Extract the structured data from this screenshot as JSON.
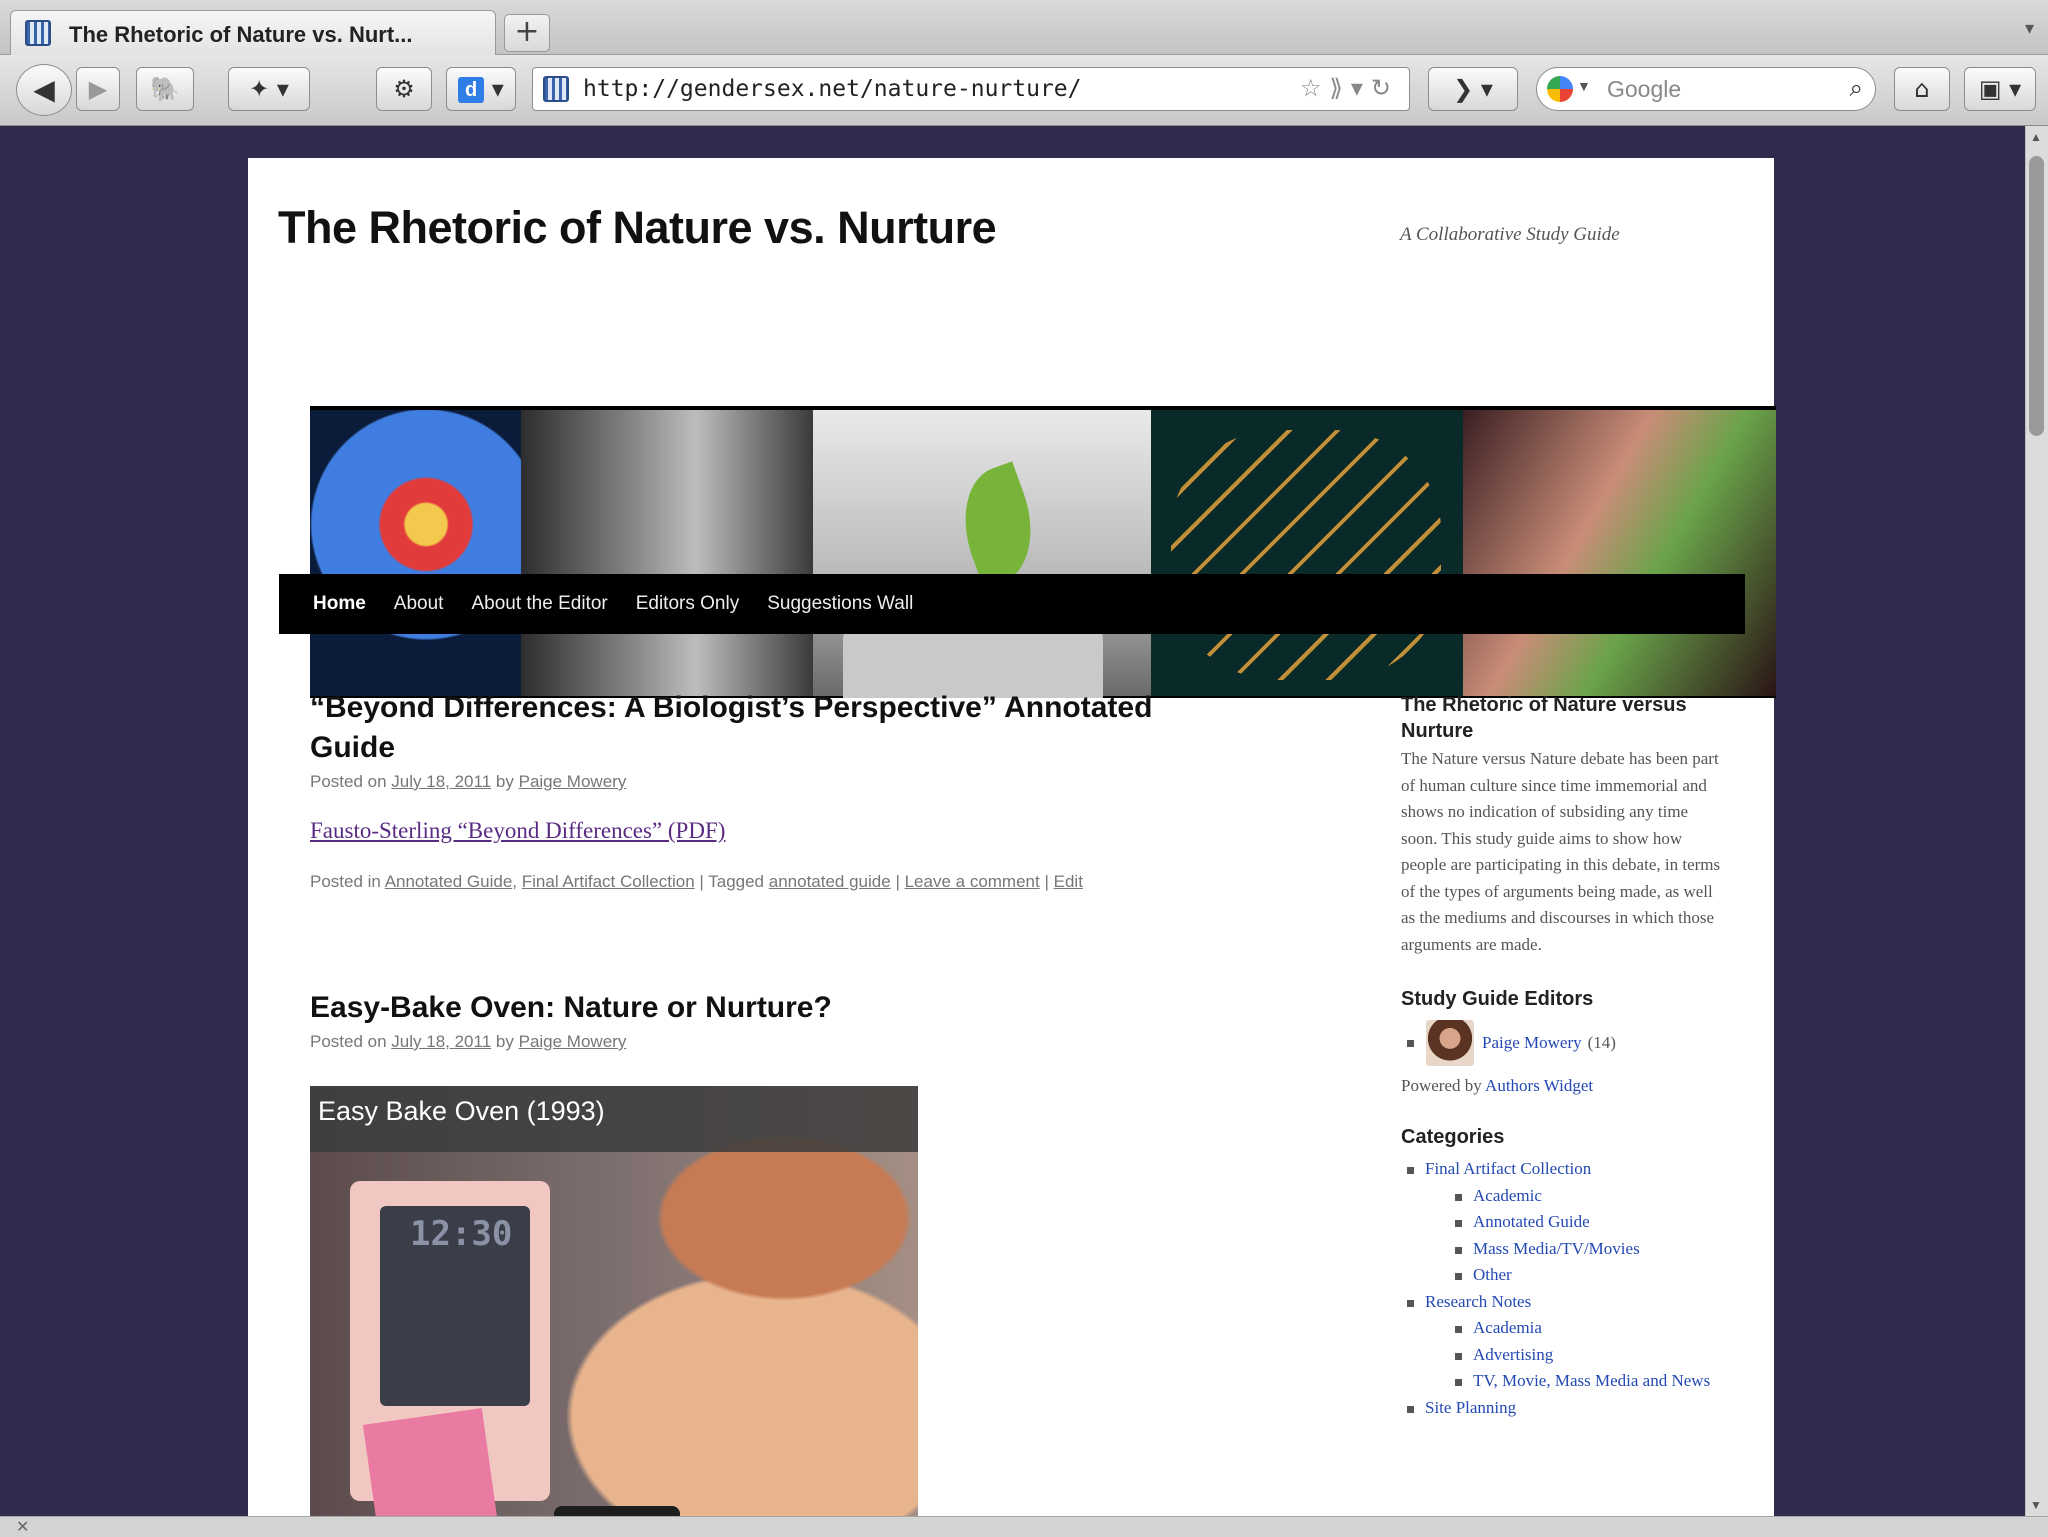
{
  "browser": {
    "tab_title": "The Rhetoric of Nature vs. Nurt...",
    "new_tab_label": "+",
    "url": "http://gendersex.net/nature-nurture/",
    "search_placeholder": "Google"
  },
  "site": {
    "title": "The Rhetoric of Nature vs. Nurture",
    "description": "A Collaborative Study Guide",
    "nav": [
      "Home",
      "About",
      "About the Editor",
      "Editors Only",
      "Suggestions Wall"
    ]
  },
  "posts": [
    {
      "title": "“Beyond Differences: A Biologist’s Perspective” Annotated Guide",
      "posted_on": "Posted on",
      "date": "July 18, 2011",
      "by": "by",
      "author": "Paige Mowery",
      "pdf_link": "Fausto-Sterling “Beyond Differences” (PDF)",
      "posted_in": "Posted in",
      "categories": [
        "Annotated Guide",
        "Final Artifact Collection"
      ],
      "tagged": "Tagged",
      "tag": "annotated guide",
      "comment_link": "Leave a comment",
      "edit_link": "Edit"
    },
    {
      "title": "Easy-Bake Oven: Nature or Nurture?",
      "posted_on": "Posted on",
      "date": "July 18, 2011",
      "by": "by",
      "author": "Paige Mowery",
      "video_title": "Easy Bake Oven (1993)",
      "video_clock": "12:30"
    }
  ],
  "sidebar": {
    "about": {
      "title": "The Rhetoric of Nature versus Nurture",
      "text": "The Nature versus Nature debate has been part of human culture since time immemorial and shows no indication of subsiding any time soon. This study guide aims to show how people are participating in this debate, in terms of the types of arguments being made, as well as the mediums and discourses in which those arguments are made."
    },
    "editors": {
      "title": "Study Guide Editors",
      "name": "Paige Mowery",
      "count": "(14)",
      "powered_by": "Powered by",
      "widget_link": "Authors Widget"
    },
    "categories": {
      "title": "Categories",
      "items": [
        {
          "label": "Final Artifact Collection",
          "children": [
            "Academic",
            "Annotated Guide",
            "Mass Media/TV/Movies",
            "Other"
          ]
        },
        {
          "label": "Research Notes",
          "children": [
            "Academia",
            "Advertising",
            "TV, Movie, Mass Media and News"
          ]
        },
        {
          "label": "Site Planning",
          "children": []
        }
      ]
    }
  },
  "colors": {
    "background": "#322a4d",
    "link": "#2349b3",
    "visited_link": "#5a2b83",
    "nav_bg": "#000000"
  }
}
